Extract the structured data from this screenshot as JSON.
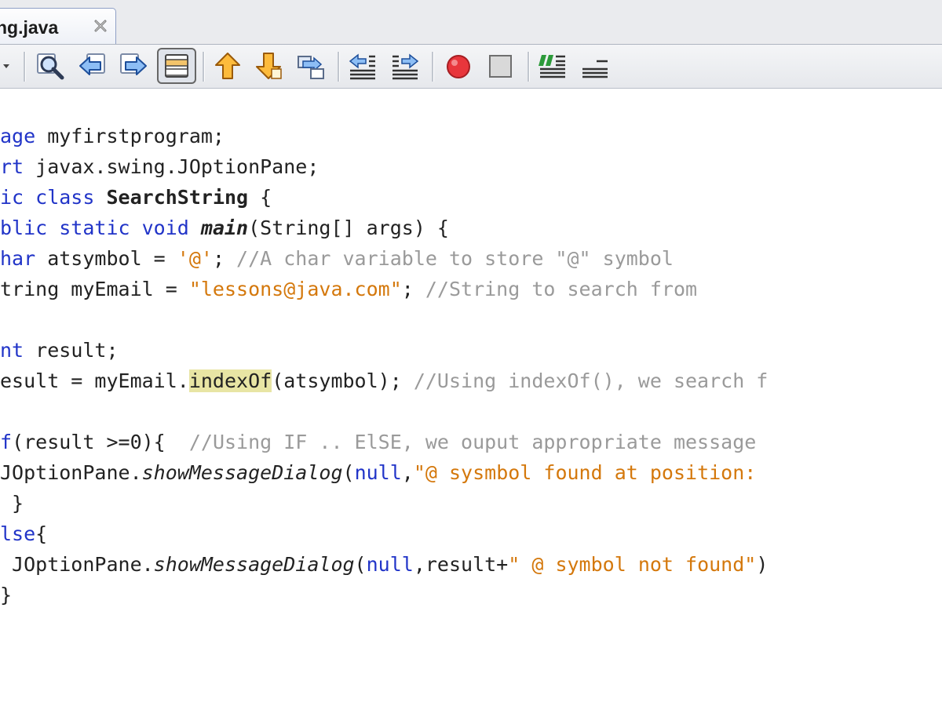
{
  "tab": {
    "label": "ng.java",
    "close_icon": "close-icon"
  },
  "toolbar": {
    "buttons": [
      "dropdown-arrow-icon",
      "find-icon",
      "find-previous-icon",
      "find-next-icon",
      "toggle-highlight-icon",
      "previous-bookmark-icon",
      "next-bookmark-icon",
      "toggle-bookmark-icon",
      "shift-left-icon",
      "shift-right-icon",
      "start-macro-recording-icon",
      "stop-macro-recording-icon",
      "comment-icon",
      "uncomment-icon"
    ]
  },
  "code": {
    "lines": [
      [
        {
          "t": "age",
          "c": "kw"
        },
        {
          "t": " myfirstprogram;",
          "c": ""
        }
      ],
      [
        {
          "t": "rt",
          "c": "kw"
        },
        {
          "t": " javax.swing.JOptionPane;",
          "c": ""
        }
      ],
      [
        {
          "t": "ic class",
          "c": "kw"
        },
        {
          "t": " ",
          "c": ""
        },
        {
          "t": "SearchString",
          "c": "bd"
        },
        {
          "t": " {",
          "c": ""
        }
      ],
      [
        {
          "t": "blic static void",
          "c": "kw"
        },
        {
          "t": " ",
          "c": ""
        },
        {
          "t": "main",
          "c": "bi"
        },
        {
          "t": "(String[] args) {",
          "c": ""
        }
      ],
      [
        {
          "t": "har",
          "c": "kw"
        },
        {
          "t": " atsymbol = ",
          "c": ""
        },
        {
          "t": "'@'",
          "c": "str"
        },
        {
          "t": "; ",
          "c": ""
        },
        {
          "t": "//A char variable to store \"@\" symbol",
          "c": "cmt"
        }
      ],
      [
        {
          "t": "tring myEmail = ",
          "c": ""
        },
        {
          "t": "\"lessons@java.com\"",
          "c": "str"
        },
        {
          "t": "; ",
          "c": ""
        },
        {
          "t": "//String to search from",
          "c": "cmt"
        }
      ],
      [],
      [
        {
          "t": "nt",
          "c": "kw"
        },
        {
          "t": " result;",
          "c": ""
        }
      ],
      [
        {
          "t": "esult = myEmail.",
          "c": ""
        },
        {
          "t": "indexOf",
          "c": "hl"
        },
        {
          "t": "(atsymbol); ",
          "c": ""
        },
        {
          "t": "//Using indexOf(), we search f",
          "c": "cmt"
        }
      ],
      [],
      [
        {
          "t": "f",
          "c": "kw"
        },
        {
          "t": "(result >=0){  ",
          "c": ""
        },
        {
          "t": "//Using IF .. ElSE, we ouput appropriate message",
          "c": "cmt"
        }
      ],
      [
        {
          "t": "JOptionPane.",
          "c": ""
        },
        {
          "t": "showMessageDialog",
          "c": "it"
        },
        {
          "t": "(",
          "c": ""
        },
        {
          "t": "null",
          "c": "kw"
        },
        {
          "t": ",",
          "c": ""
        },
        {
          "t": "\"@ sysmbol found at position: ",
          "c": "str"
        }
      ],
      [
        {
          "t": " }",
          "c": ""
        }
      ],
      [
        {
          "t": "lse",
          "c": "kw"
        },
        {
          "t": "{",
          "c": ""
        }
      ],
      [
        {
          "t": " JOptionPane.",
          "c": ""
        },
        {
          "t": "showMessageDialog",
          "c": "it"
        },
        {
          "t": "(",
          "c": ""
        },
        {
          "t": "null",
          "c": "kw"
        },
        {
          "t": ",result+",
          "c": ""
        },
        {
          "t": "\" @ symbol not found\"",
          "c": "str"
        },
        {
          "t": ")",
          "c": ""
        }
      ],
      [
        {
          "t": "}",
          "c": ""
        }
      ]
    ]
  },
  "colors": {
    "keyword": "#2134c8",
    "string": "#d4780c",
    "comment": "#9a9a9a",
    "highlight": "#e8e5a4",
    "record": "#e8363c"
  }
}
